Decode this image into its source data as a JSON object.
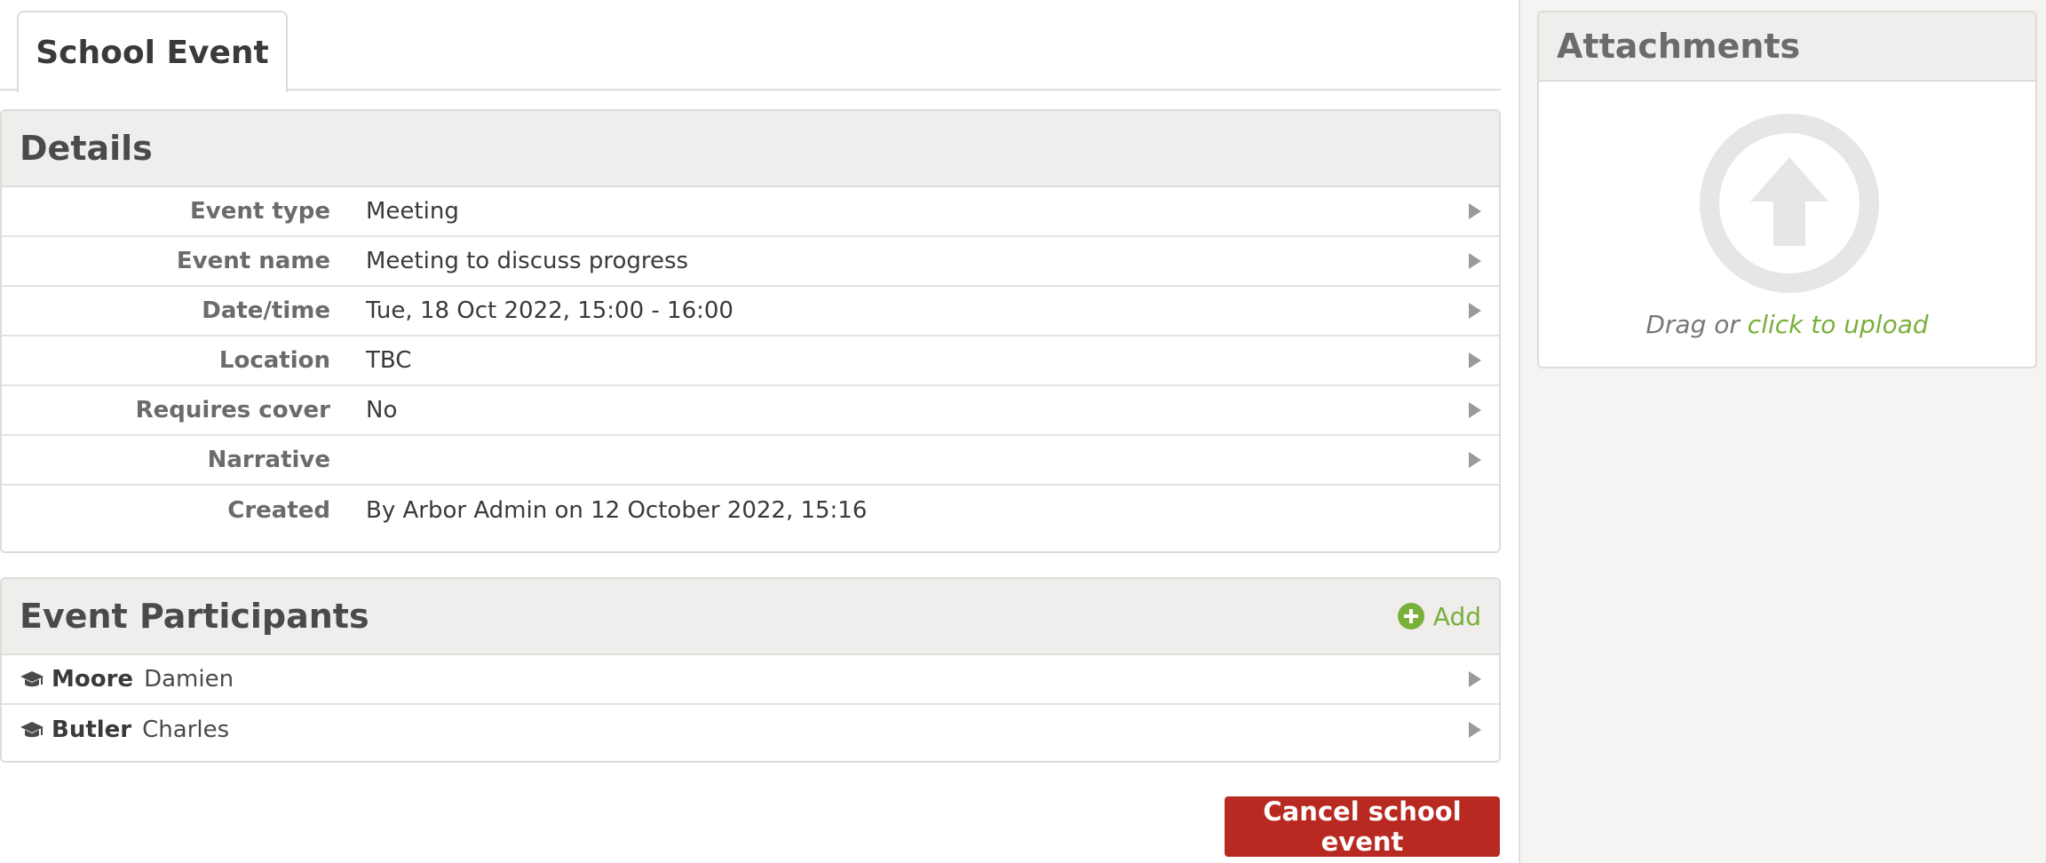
{
  "tab": {
    "label": "School Event"
  },
  "details": {
    "title": "Details",
    "rows": [
      {
        "label": "Event type",
        "value": "Meeting"
      },
      {
        "label": "Event name",
        "value": "Meeting to discuss progress"
      },
      {
        "label": "Date/time",
        "value": "Tue, 18 Oct 2022, 15:00 - 16:00"
      },
      {
        "label": "Location",
        "value": "TBC"
      },
      {
        "label": "Requires cover",
        "value": "No"
      },
      {
        "label": "Narrative",
        "value": ""
      },
      {
        "label": "Created",
        "value": "By Arbor Admin on 12 October 2022, 15:16"
      }
    ]
  },
  "participants": {
    "title": "Event Participants",
    "add_label": "Add",
    "rows": [
      {
        "surname": "Moore",
        "first": "Damien",
        "icon": "graduation-cap-icon"
      },
      {
        "surname": "Butler",
        "first": "Charles",
        "icon": "graduation-cap-icon"
      }
    ]
  },
  "actions": {
    "cancel_label": "Cancel school event"
  },
  "attachments": {
    "title": "Attachments",
    "icon": "upload-arrow-icon",
    "drag_text": "Drag or",
    "upload_link": "click to upload"
  },
  "colors": {
    "accent_green": "#79b03a",
    "danger_red": "#b82a21",
    "header_gray": "#efeeec"
  }
}
